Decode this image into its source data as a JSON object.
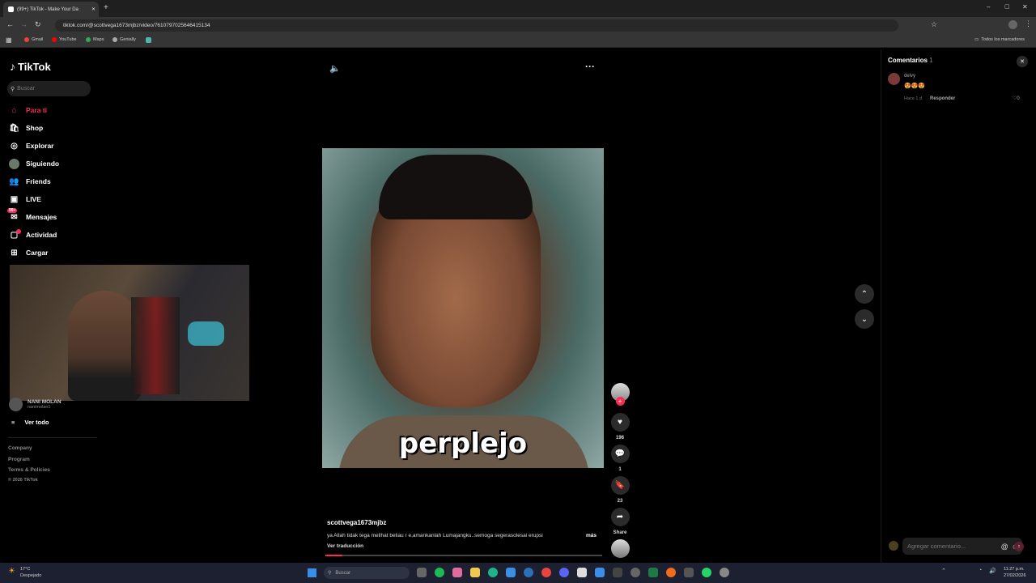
{
  "browser": {
    "tab_title": "(99+) TikTok - Make Your Da",
    "url": "tiktok.com/@scottvega1673mjbz/video/7610797025646415134",
    "bookmarks": [
      "Gmail",
      "YouTube",
      "Maps",
      "Genially"
    ],
    "all_bookmarks": "Todos los marcadores"
  },
  "sidebar": {
    "logo": "TikTok",
    "search_placeholder": "Buscar",
    "items": [
      {
        "label": "Para ti",
        "active": true
      },
      {
        "label": "Shop"
      },
      {
        "label": "Explorar"
      },
      {
        "label": "Siguiendo"
      },
      {
        "label": "Friends"
      },
      {
        "label": "LIVE"
      },
      {
        "label": "Mensajes",
        "badge": "99+"
      },
      {
        "label": "Actividad"
      },
      {
        "label": "Cargar"
      }
    ],
    "following_user": {
      "name": "NANI MOLAN",
      "handle": "nanimolan1"
    },
    "see_all": "Ver todo",
    "footer": [
      "Company",
      "Program",
      "Terms & Policies",
      "© 2026 TikTok"
    ]
  },
  "video": {
    "overlay_text": "perplejo",
    "author": "scottvega1673mjbz",
    "description": "ya Allah tidak tega melihat beliau r e,amankanlah Lumajangku..semoga segerasolesai erupsi",
    "more": "más",
    "translate": "Ver traducción",
    "likes": "196",
    "comments": "1",
    "saves": "23",
    "share": "Share"
  },
  "comments_panel": {
    "title": "Comentarios",
    "count": "1",
    "items": [
      {
        "user": "deivy",
        "text": "😍😍😍",
        "time": "Hace 1 d",
        "reply": "Responder",
        "likes": "0"
      }
    ],
    "input_placeholder": "Agregar comentario..."
  },
  "taskbar": {
    "weather_temp": "17°C",
    "weather_desc": "Despejado",
    "search": "Buscar",
    "time": "11:27 p.m.",
    "date": "27/02/2026"
  },
  "colors": {
    "accent": "#fe2c55",
    "bg": "#000000"
  }
}
